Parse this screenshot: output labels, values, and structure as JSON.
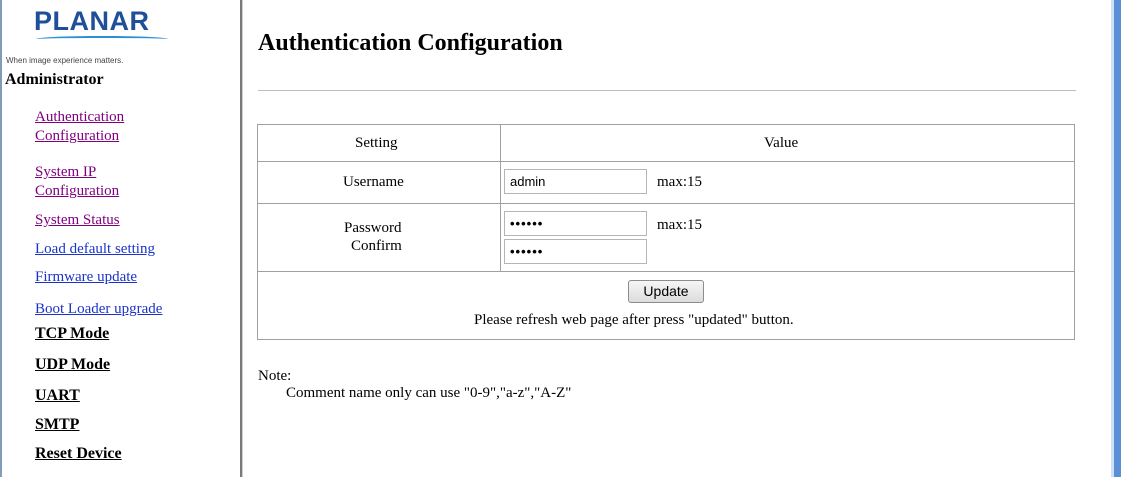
{
  "logo": {
    "word": "PLANAR",
    "tagline": "When image experience matters."
  },
  "sidebar": {
    "heading": "Administrator",
    "links": [
      {
        "label_line1": "Authentication",
        "label_line2": "Configuration",
        "state": "visited"
      },
      {
        "label_line1": "System IP",
        "label_line2": "Configuration",
        "state": "visited"
      },
      {
        "label": "System Status",
        "state": "visited"
      },
      {
        "label": "Load default setting",
        "state": "unvisited"
      },
      {
        "label": "Firmware update",
        "state": "unvisited"
      },
      {
        "label": "Boot Loader upgrade",
        "state": "unvisited"
      }
    ],
    "sections": [
      "TCP Mode",
      "UDP Mode",
      "UART",
      "SMTP",
      "Reset Device"
    ]
  },
  "main": {
    "title": "Authentication Configuration",
    "table": {
      "header_setting": "Setting",
      "header_value": "Value",
      "username_label": "Username",
      "username_value": "admin",
      "username_hint": "max:15",
      "password_label": "Password",
      "confirm_label": "Confirm",
      "password_value": "••••••",
      "confirm_value": "••••••",
      "password_hint": "max:15",
      "update_button": "Update",
      "refresh_note": "Please refresh web page after press \"updated\" button."
    },
    "note_label": "Note:",
    "note_text": "Comment name only can use \"0-9\",\"a-z\",\"A-Z\""
  },
  "colors": {
    "brand_blue": "#1f4f99",
    "visited_link": "#800080",
    "unvisited_link": "#1a33cc"
  }
}
